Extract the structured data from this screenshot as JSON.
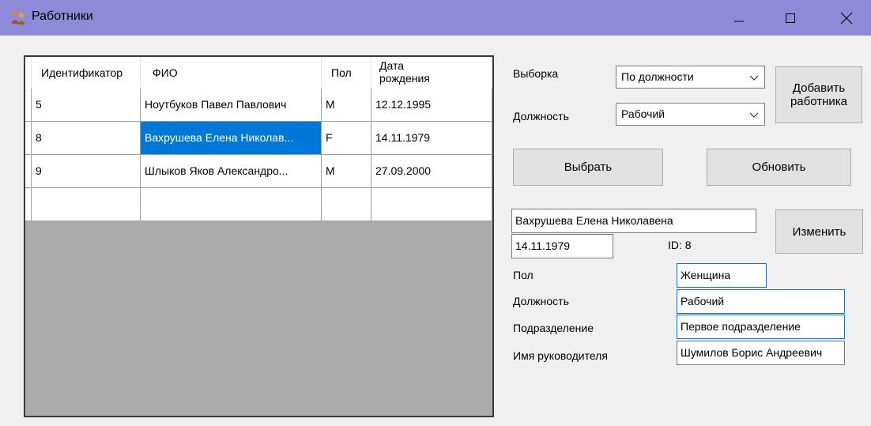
{
  "window": {
    "title": "Работники",
    "minimize_icon": "minimize-icon",
    "maximize_icon": "maximize-icon",
    "close_icon": "close-icon"
  },
  "grid": {
    "columns": [
      "Идентификатор",
      "ФИО",
      "Пол",
      "Дата рождения"
    ],
    "date_col_line1": "Дата",
    "date_col_line2": "рождения",
    "rows": [
      {
        "id": "5",
        "name": "Ноутбуков Павел Павлович",
        "gender": "M",
        "birth": "12.12.1995"
      },
      {
        "id": "8",
        "name": "Вахрушева Елена Николав...",
        "gender": "F",
        "birth": "14.11.1979"
      },
      {
        "id": "9",
        "name": "Шлыков Яков Александро...",
        "gender": "M",
        "birth": "27.09.2000"
      }
    ]
  },
  "filter": {
    "selection_label": "Выборка",
    "selection_value": "По должности",
    "position_label": "Должность",
    "position_value": "Рабочий"
  },
  "buttons": {
    "add_line1": "Добавить",
    "add_line2": "работника",
    "select": "Выбрать",
    "refresh": "Обновить",
    "edit": "Изменить"
  },
  "details": {
    "full_name": "Вахрушева Елена Николавена",
    "birth_date": "14.11.1979",
    "id_text": "ID: 8",
    "gender_label": "Пол",
    "gender_value": "Женщина",
    "position_label": "Должность",
    "position_value": "Рабочий",
    "department_label": "Подразделение",
    "department_value": "Первое подразделение",
    "manager_label": "Имя руководителя",
    "manager_value": "Шумилов Борис Андреевич"
  }
}
